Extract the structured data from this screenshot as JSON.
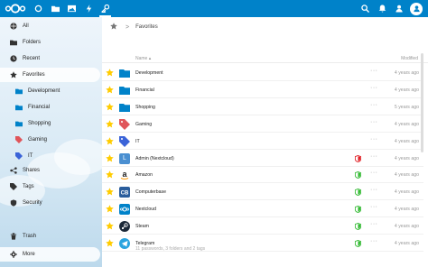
{
  "colors": {
    "brand": "#0082c9",
    "star": "#ffcc00",
    "folder": "#0082c9",
    "shield_green": "#2eb82e",
    "shield_red": "#e0191f"
  },
  "topbar": {
    "left_icons": [
      "nextcloud-logo",
      "dashboard-icon",
      "files-icon",
      "photos-icon",
      "activity-icon",
      "passwords-icon"
    ],
    "right_icons": [
      "search-icon",
      "notifications-icon",
      "contacts-icon",
      "user-avatar-icon"
    ]
  },
  "sidebar": {
    "items": [
      {
        "label": "All",
        "icon": "globe-icon"
      },
      {
        "label": "Folders",
        "icon": "folder-icon"
      },
      {
        "label": "Recent",
        "icon": "clock-icon"
      },
      {
        "label": "Favorites",
        "icon": "star-icon"
      },
      {
        "label": "Development",
        "icon": "folder-icon"
      },
      {
        "label": "Financial",
        "icon": "folder-icon"
      },
      {
        "label": "Shopping",
        "icon": "folder-icon"
      },
      {
        "label": "Gaming",
        "icon": "tag-icon"
      },
      {
        "label": "IT",
        "icon": "tag-icon"
      },
      {
        "label": "Shares",
        "icon": "share-icon"
      },
      {
        "label": "Tags",
        "icon": "tag-icon"
      },
      {
        "label": "Security",
        "icon": "shield-icon"
      },
      {
        "label": "Trash",
        "icon": "trash-icon"
      },
      {
        "label": "More",
        "icon": "gear-icon"
      }
    ]
  },
  "breadcrumb": {
    "separator": ">",
    "current": "Favorites"
  },
  "table": {
    "header_name": "Name ▴",
    "header_modified": "Modified",
    "more_glyph": "···",
    "rows": [
      {
        "name": "Development",
        "type": "folder",
        "date": "4 years ago"
      },
      {
        "name": "Financial",
        "type": "folder",
        "date": "4 years ago"
      },
      {
        "name": "Shopping",
        "type": "folder",
        "date": "5 years ago"
      },
      {
        "name": "Gaming",
        "type": "tag",
        "tag_color": "#e0555a",
        "date": "4 years ago"
      },
      {
        "name": "IT",
        "type": "tag",
        "tag_color": "#3a63d8",
        "date": "4 years ago"
      },
      {
        "name": "Admin (Nextcloud)",
        "type": "letter",
        "letter": "L",
        "shield": "red",
        "date": "4 years ago"
      },
      {
        "name": "Amazon",
        "type": "amazon",
        "shield": "green",
        "date": "4 years ago"
      },
      {
        "name": "Computerbase",
        "type": "cb",
        "shield": "green",
        "date": "4 years ago"
      },
      {
        "name": "Nextcloud",
        "type": "nc",
        "shield": "green",
        "date": "4 years ago"
      },
      {
        "name": "Steam",
        "type": "steam",
        "shield": "green",
        "date": "4 years ago"
      },
      {
        "name": "Telegram",
        "type": "telegram",
        "shield": "green",
        "date": "4 years ago"
      }
    ],
    "summary": "11 passwords, 3 folders and 2 tags"
  }
}
